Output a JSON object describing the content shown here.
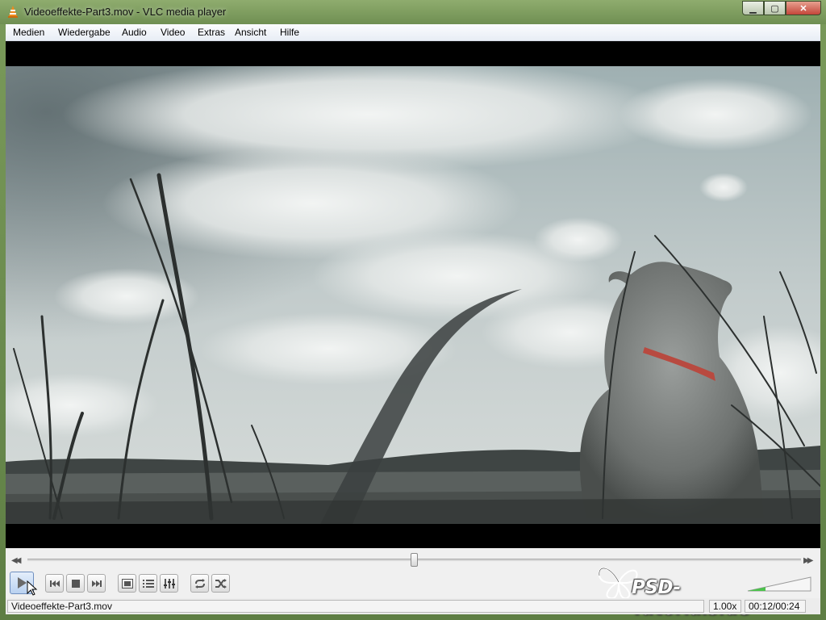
{
  "window": {
    "title": "Videoeffekte-Part3.mov - VLC media player",
    "minimize_glyph": "▁",
    "maximize_glyph": "▢",
    "close_glyph": "✕"
  },
  "menu": {
    "items": [
      "Medien",
      "Wiedergabe",
      "Audio",
      "Video",
      "Extras",
      "Ansicht",
      "Hilfe"
    ]
  },
  "controls": {
    "seek_back_icon": "rewind-icon",
    "seek_forward_icon": "fast-forward-icon",
    "position_fraction": 0.5
  },
  "watermark": {
    "text": "PSD-Tutorials.de"
  },
  "status": {
    "filename": "Videoeffekte-Part3.mov",
    "speed": "1.00x",
    "time": "00:12/00:24"
  },
  "colors": {
    "accent": "#3c7fd0",
    "volume_green": "#4cc24c"
  }
}
